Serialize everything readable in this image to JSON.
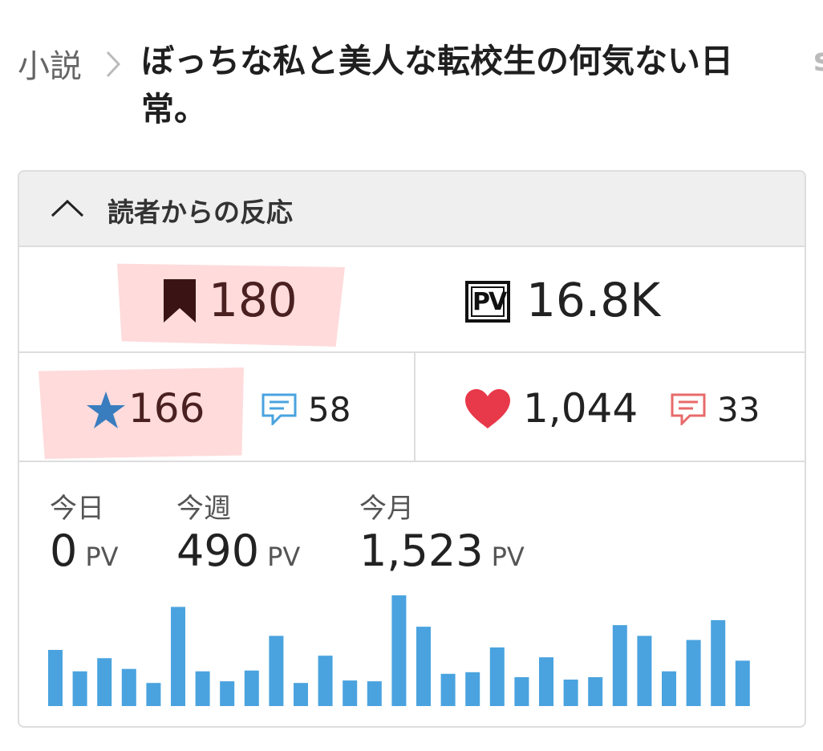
{
  "breadcrumb": {
    "root": "小説",
    "title": "ぼっちな私と美人な転校生の何気ない日常。",
    "edge_glyph": "s"
  },
  "reactions": {
    "header": "読者からの反応",
    "bookmarks": "180",
    "page_views_total": "16.8K",
    "pv_badge": "PV",
    "stars": "166",
    "reviews": "58",
    "hearts": "1,044",
    "cheer_comments": "33"
  },
  "stats": {
    "today_label": "今日",
    "today_value": "0",
    "week_label": "今週",
    "week_value": "490",
    "month_label": "今月",
    "month_value": "1,523",
    "unit": "PV"
  },
  "chart_data": {
    "type": "bar",
    "color": "#4aa3df",
    "values": [
      68,
      42,
      58,
      45,
      28,
      120,
      42,
      30,
      43,
      85,
      28,
      61,
      31,
      30,
      134,
      96,
      39,
      41,
      71,
      35,
      59,
      32,
      35,
      98,
      85,
      42,
      80,
      104,
      55
    ]
  },
  "colors": {
    "accent_highlight": "#ffafaf",
    "bookmark": "#3a1414",
    "star": "#3a7dbf",
    "heart": "#e8394a",
    "comment_blue": "#4aa3df",
    "comment_red": "#e86a6a"
  }
}
